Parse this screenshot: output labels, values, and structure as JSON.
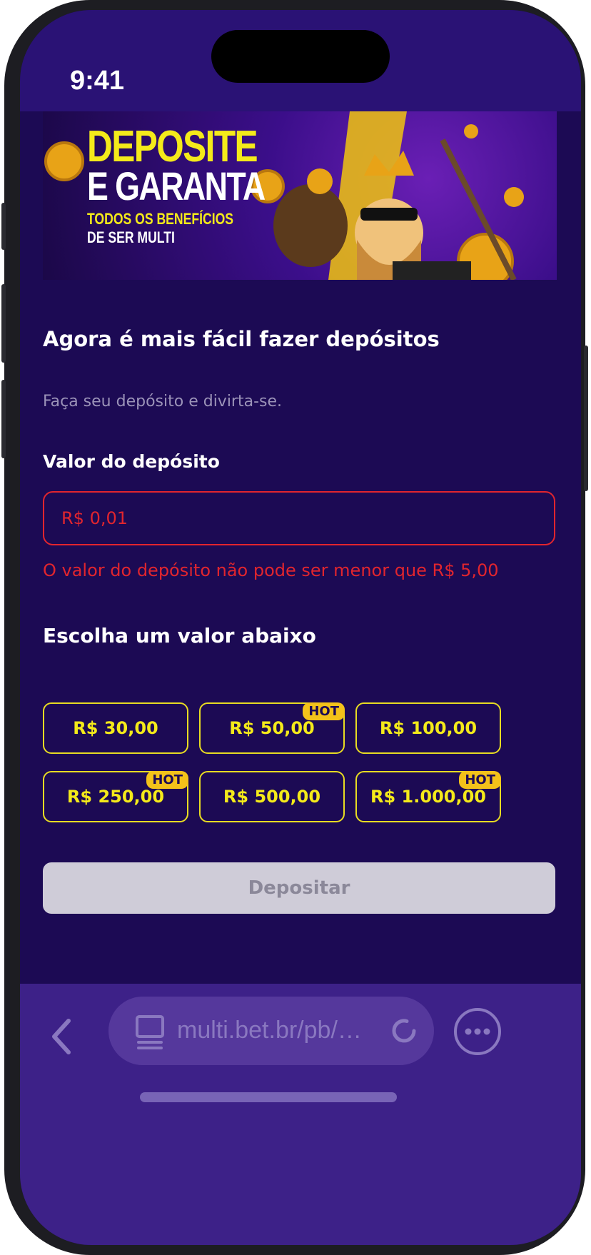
{
  "status_bar": {
    "time": "9:41"
  },
  "banner": {
    "line1": "DEPOSITE",
    "line2": "E GARANTA",
    "line3": "TODOS OS BENEFÍCIOS",
    "line4": "DE SER MULTI"
  },
  "page": {
    "title": "Agora é mais fácil fazer depósitos",
    "subtitle": "Faça seu depósito e divirta-se."
  },
  "deposit": {
    "label": "Valor do depósito",
    "input_value": "R$ 0,01",
    "error": "O valor do depósito não pode ser menor que R$ 5,00",
    "choose_label": "Escolha um valor abaixo",
    "hot_label": "HOT",
    "options": [
      {
        "label": "R$ 30,00",
        "hot": false
      },
      {
        "label": "R$ 50,00",
        "hot": true
      },
      {
        "label": "R$ 100,00",
        "hot": false
      },
      {
        "label": "R$ 250,00",
        "hot": true
      },
      {
        "label": "R$ 500,00",
        "hot": false
      },
      {
        "label": "R$ 1.000,00",
        "hot": true
      }
    ],
    "submit_label": "Depositar"
  },
  "browser": {
    "url": "multi.bet.br/pb/…",
    "icons": [
      "chevron-left-icon",
      "page-icon",
      "reload-icon",
      "more-icon"
    ]
  },
  "colors": {
    "background": "#1c0a54",
    "accent_yellow": "#f4ea1a",
    "error_red": "#e1252e",
    "hot_badge": "#f3c21a",
    "browser_bar": "#3d2188"
  }
}
